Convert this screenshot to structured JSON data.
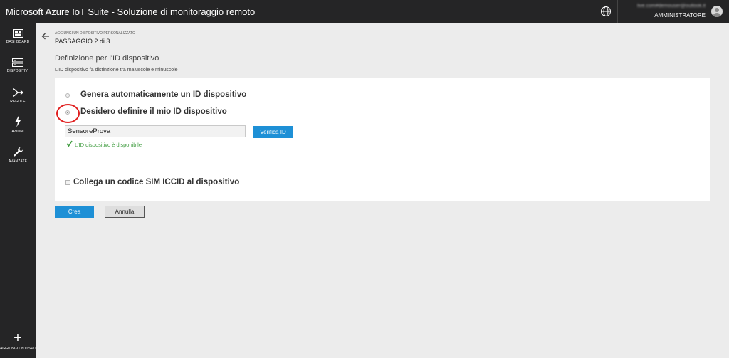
{
  "app": {
    "title": "Microsoft Azure IoT Suite - Soluzione di monitoraggio remoto"
  },
  "header": {
    "globe_icon": "globe-icon",
    "user_email": "live.com#demouser@outlook.it",
    "user_role": "AMMINISTRATORE",
    "avatar_icon": "user-avatar-icon"
  },
  "sidebar": {
    "items": [
      {
        "label": "DASHBOARD",
        "icon": "dashboard-icon"
      },
      {
        "label": "DISPOSITIVI",
        "icon": "devices-icon"
      },
      {
        "label": "REGOLE",
        "icon": "rules-icon"
      },
      {
        "label": "AZIONI",
        "icon": "actions-icon"
      },
      {
        "label": "AVANZATE",
        "icon": "wrench-icon"
      }
    ],
    "add_device": {
      "label": "AGGIUNGI UN DISPO...",
      "icon": "plus-icon"
    }
  },
  "page": {
    "breadcrumb": "AGGIUNGI UN DISPOSITIVO PERSONALIZZATO",
    "step": "PASSAGGIO 2 di 3",
    "section_title": "Definizione per l'ID dispositivo",
    "section_desc": "L'ID dispositivo fa distinzione tra maiuscole e minuscole"
  },
  "form": {
    "option_auto": "Genera automaticamente un ID dispositivo",
    "option_custom": "Desidero definire il mio ID dispositivo",
    "selected_option": "custom",
    "device_id_value": "SensoreProva",
    "verify_label": "Verifica ID",
    "availability_text": "L'ID dispositivo è disponibile",
    "sim_label": "Collega un codice SIM ICCID al dispositivo",
    "sim_checked": false
  },
  "actions": {
    "create_label": "Crea",
    "cancel_label": "Annulla"
  },
  "colors": {
    "accent": "#1e90d6",
    "topbar": "#252526",
    "success": "#3f9c3f",
    "highlight": "#e02020"
  }
}
